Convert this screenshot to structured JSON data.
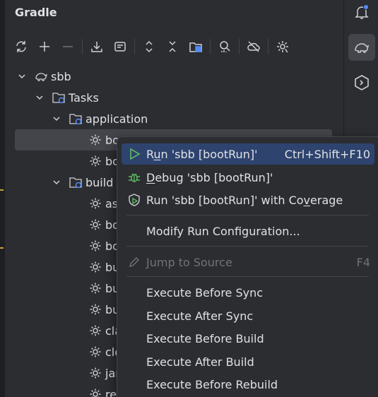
{
  "panel": {
    "title": "Gradle",
    "toolbar": [
      {
        "name": "reload-icon"
      },
      {
        "name": "add-icon"
      },
      {
        "name": "remove-icon"
      },
      {
        "name": "download-icon"
      },
      {
        "name": "toggle-offline-icon"
      },
      {
        "name": "expand-all-icon"
      },
      {
        "name": "collapse-all-icon"
      },
      {
        "name": "group-modules-icon"
      },
      {
        "name": "analyze-dependencies-icon"
      },
      {
        "name": "offline-mode-icon"
      },
      {
        "name": "gradle-settings-icon"
      }
    ]
  },
  "tree": {
    "root": "sbb",
    "tasks": "Tasks",
    "application": "application",
    "app_items": [
      "bootRun",
      "bootTestRun"
    ],
    "app_items_visible": [
      "boo",
      "boo"
    ],
    "build": "build",
    "build_items_visible": [
      "ass",
      "boo",
      "boo",
      "bui",
      "bui",
      "bui",
      "cla",
      "cle",
      "jar",
      "res"
    ]
  },
  "context_menu": {
    "items": [
      {
        "pre": "R",
        "mnemonic": "u",
        "post": "n 'sbb [bootRun]'",
        "shortcut": "Ctrl+Shift+F10",
        "icon": "run-icon"
      },
      {
        "pre": "",
        "mnemonic": "D",
        "post": "ebug 'sbb [bootRun]'",
        "shortcut": "",
        "icon": "debug-icon"
      },
      {
        "pre": "Run 'sbb [bootRun]' with Co",
        "mnemonic": "v",
        "post": "erage",
        "shortcut": "",
        "icon": "coverage-icon"
      },
      {
        "pre": "Modify Run Configuration...",
        "mnemonic": "",
        "post": "",
        "shortcut": "",
        "icon": ""
      },
      {
        "pre": "",
        "mnemonic": "J",
        "post": "ump to Source",
        "shortcut": "F4",
        "icon": "edit-icon"
      },
      {
        "pre": "Execute Before Sync",
        "mnemonic": "",
        "post": "",
        "shortcut": "",
        "icon": ""
      },
      {
        "pre": "Execute After Sync",
        "mnemonic": "",
        "post": "",
        "shortcut": "",
        "icon": ""
      },
      {
        "pre": "Execute Before Build",
        "mnemonic": "",
        "post": "",
        "shortcut": "",
        "icon": ""
      },
      {
        "pre": "Execute After Build",
        "mnemonic": "",
        "post": "",
        "shortcut": "",
        "icon": ""
      },
      {
        "pre": "Execute Before Rebuild",
        "mnemonic": "",
        "post": "",
        "shortcut": "",
        "icon": ""
      }
    ]
  },
  "right_bar": [
    {
      "name": "notifications-icon"
    },
    {
      "name": "gradle-icon"
    },
    {
      "name": "services-icon"
    }
  ],
  "colors": {
    "background": "#2b2d30",
    "selection": "#43454a",
    "menu_hover": "#2e436e",
    "run_green": "#5fb865",
    "notification_dot": "#548af7"
  }
}
